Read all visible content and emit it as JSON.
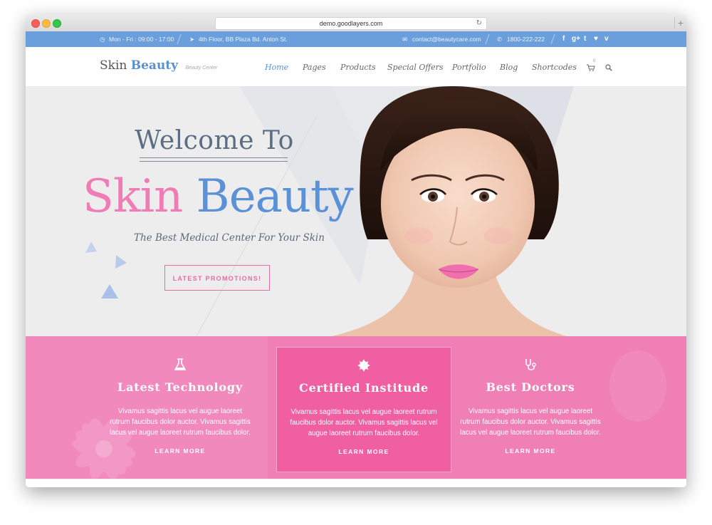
{
  "browser": {
    "url": "demo.goodlayers.com"
  },
  "topbar": {
    "hours": "Mon - Fri : 09:00 - 17:00",
    "address": "4th Floor, BB Plaza Bd. Anton St.",
    "email": "contact@beautycare.com",
    "phone": "1800-222-222",
    "social": [
      "f",
      "g+",
      "t",
      "♥",
      "v"
    ]
  },
  "logo": {
    "word1": "Skin",
    "word2": "Beauty",
    "tagline": "Beauty Center"
  },
  "menu": [
    "Home",
    "Pages",
    "Products",
    "Special Offers",
    "Portfolio",
    "Blog",
    "Shortcodes"
  ],
  "cart": {
    "count": "0"
  },
  "hero": {
    "welcome": "Welcome To",
    "brand_pink": "Skin",
    "brand_blue": "Beauty",
    "tagline": "The Best Medical Center For Your Skin",
    "button": "LATEST PROMOTIONS!"
  },
  "features": [
    {
      "icon": "flask-icon",
      "title": "Latest Technology",
      "body": "Vivamus sagittis lacus vel augue laoreet rutrum faucibus dolor auctor. Vivamus sagittis lacus vel augue laoreet rutrum faucibus dolor.",
      "link": "LEARN MORE"
    },
    {
      "icon": "badge-icon",
      "title": "Certified Institude",
      "body": "Vivamus sagittis lacus vel augue laoreet rutrum faucibus dolor auctor. Vivamus sagittis lacus vel augue laoreet rutrum faucibus dolor.",
      "link": "LEARN MORE"
    },
    {
      "icon": "stethoscope-icon",
      "title": "Best Doctors",
      "body": "Vivamus sagittis lacus vel augue laoreet rutrum faucibus dolor auctor. Vivamus sagittis lacus vel augue laoreet rutrum faucibus dolor.",
      "link": "LEARN MORE"
    }
  ],
  "colors": {
    "topbar": "#6b9fdc",
    "accent_blue": "#5b91d6",
    "accent_pink": "#f07cb6",
    "features_bg": "#f07fb6"
  }
}
